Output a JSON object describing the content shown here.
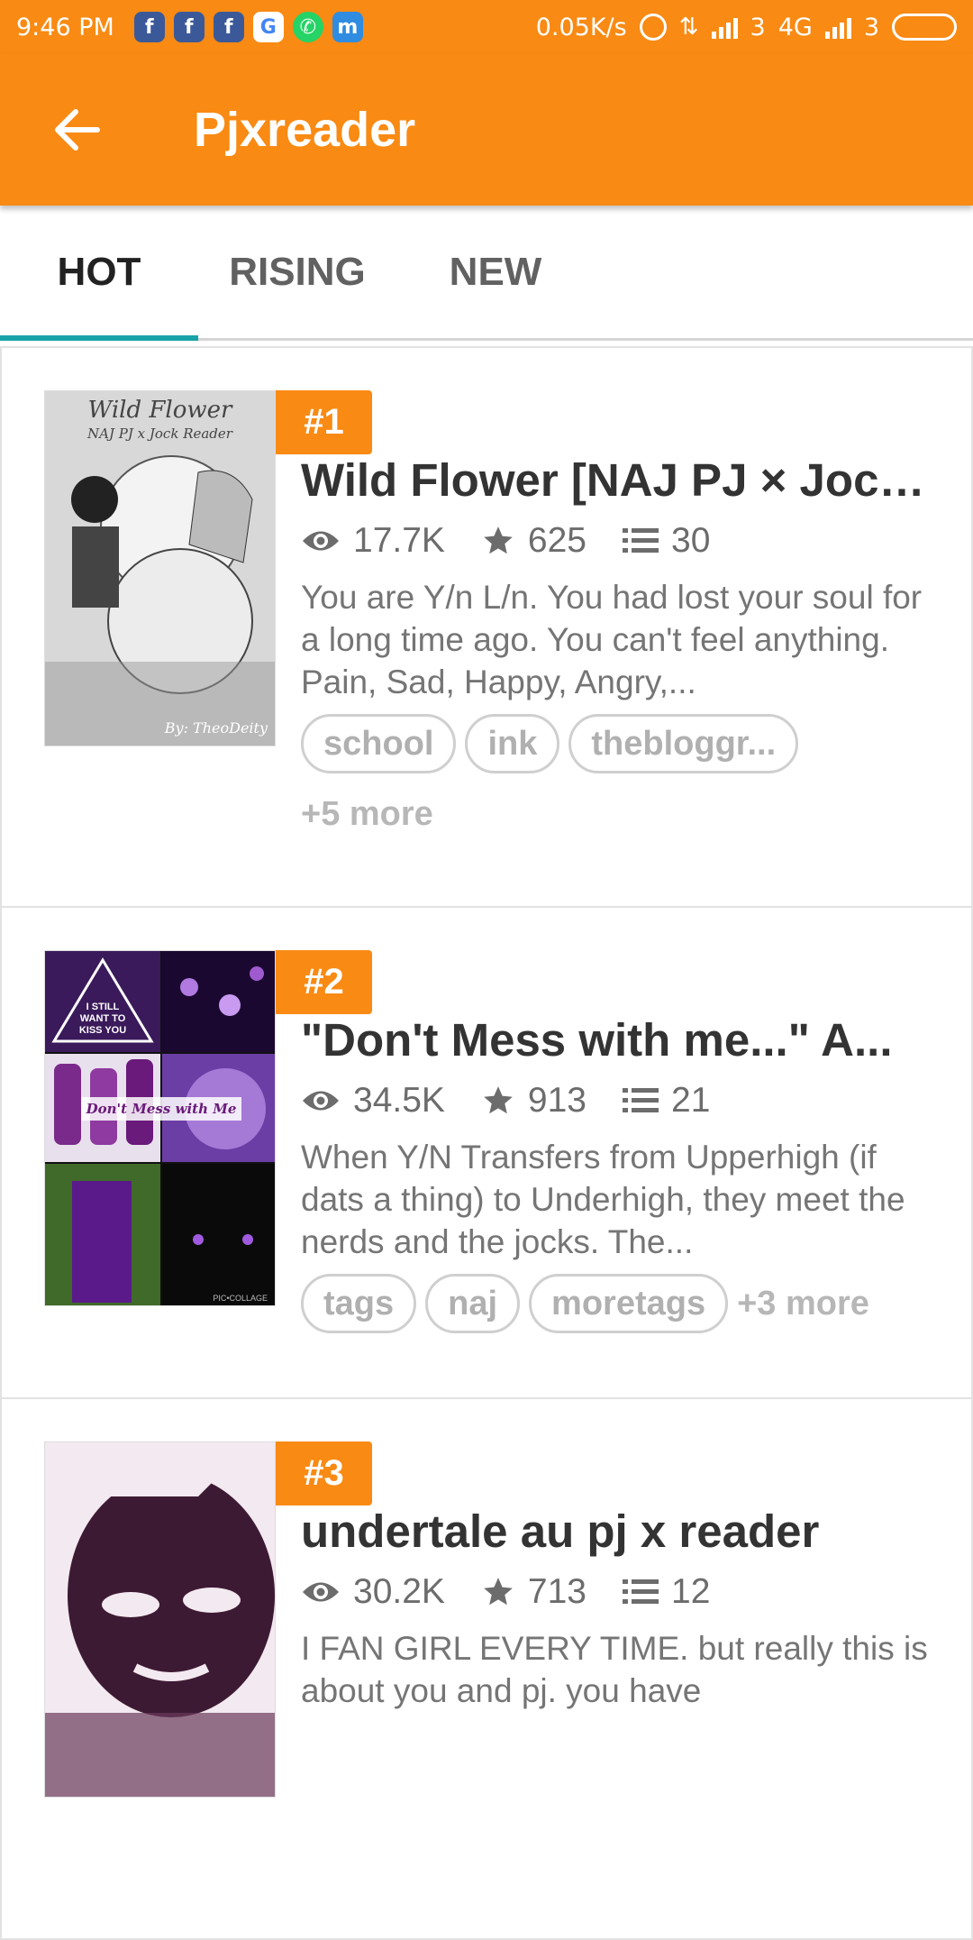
{
  "status_bar": {
    "time": "9:46 PM",
    "app_icons": [
      "facebook-icon",
      "facebook-icon",
      "facebook-icon",
      "google-icon",
      "whatsapp-icon",
      "mi-icon"
    ],
    "network_speed": "0.05K/s",
    "sim1_label": "3",
    "network_type": "4G",
    "sim2_label": "3"
  },
  "app_bar": {
    "title": "Pjxreader",
    "back_icon": "arrow-left-icon"
  },
  "tabs": [
    {
      "label": "HOT",
      "active": true
    },
    {
      "label": "RISING",
      "active": false
    },
    {
      "label": "NEW",
      "active": false
    }
  ],
  "stories": [
    {
      "rank": "#1",
      "title": "Wild Flower [NAJ PJ × Jock Reader]",
      "views": "17.7K",
      "votes": "625",
      "parts": "30",
      "description": "You are Y/n L/n. You had lost your soul for a long time ago. You can't feel anything. Pain, Sad, Happy, Angry,...",
      "tags": [
        "school",
        "ink",
        "thebloggr..."
      ],
      "more_tags": "+5 more",
      "cover_text": [
        "Wild Flower",
        "NAJ PJ x Jock Reader",
        "By: TheoDeity"
      ]
    },
    {
      "rank": "#2",
      "title": "\"Don't Mess with me...\" A...",
      "views": "34.5K",
      "votes": "913",
      "parts": "21",
      "description": "When Y/N Transfers from Upperhigh (if dats a thing) to Underhigh, they meet the nerds and the jocks. The...",
      "tags": [
        "tags",
        "naj",
        "moretags"
      ],
      "more_tags": "+3 more",
      "cover_text": [
        "I STILL WANT TO KISS YOU",
        "Don't Mess with Me",
        "PIC•COLLAGE"
      ]
    },
    {
      "rank": "#3",
      "title": "undertale au pj x reader",
      "views": "30.2K",
      "votes": "713",
      "parts": "12",
      "description": "I FAN GIRL EVERY TIME. but really this is about you and pj. you have"
    }
  ],
  "colors": {
    "accent": "#f98a13",
    "tab_indicator": "#19a3a8",
    "text_dark": "#333333",
    "text_muted": "#757575"
  }
}
